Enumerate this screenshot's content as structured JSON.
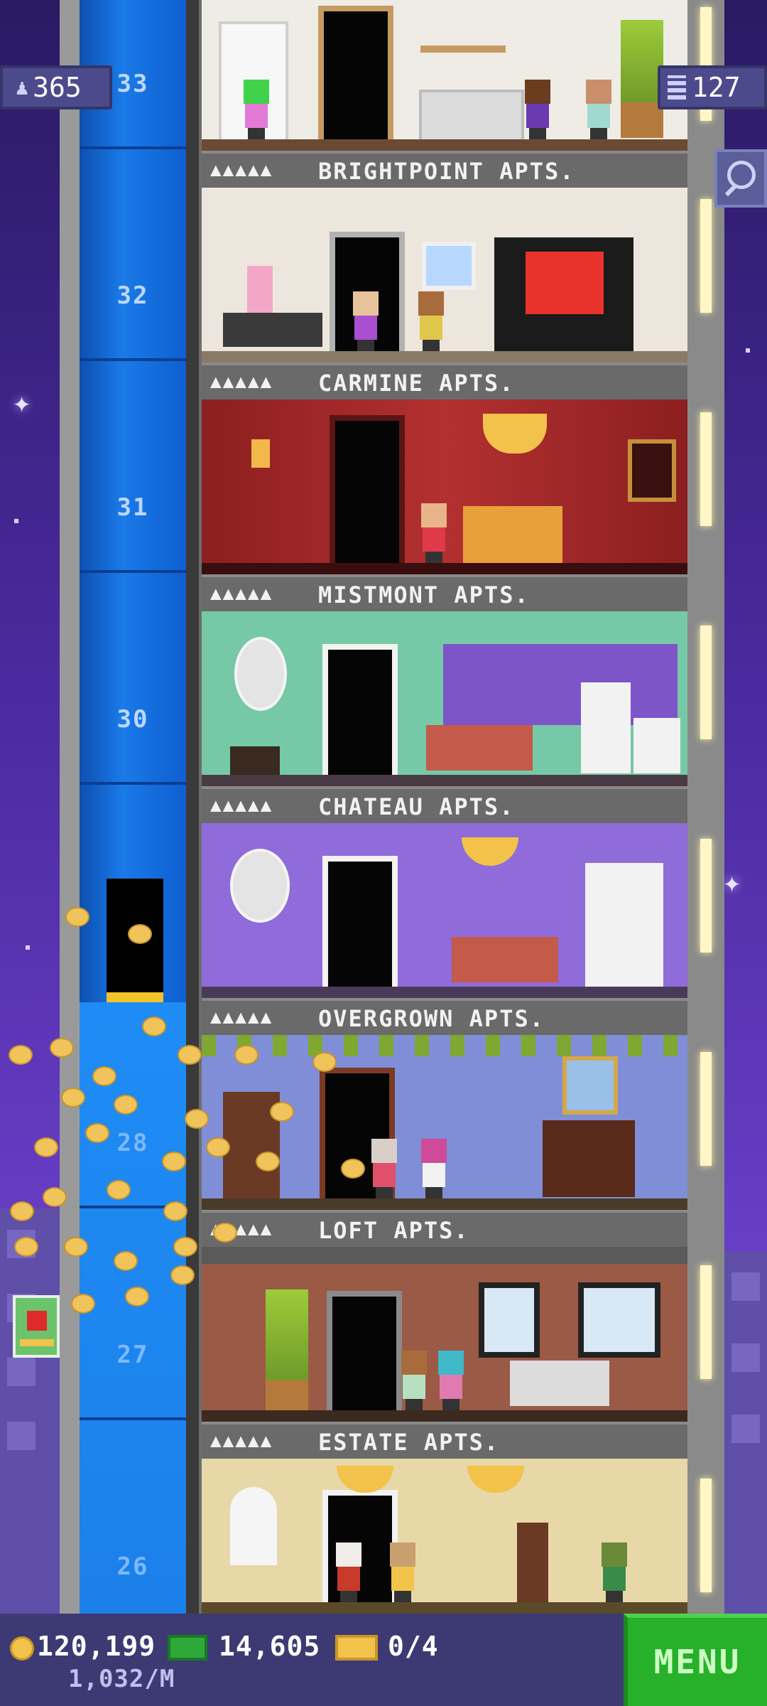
{
  "hud": {
    "population": "365",
    "floors_count": "127",
    "coins": "120,199",
    "bux": "14,605",
    "vip_cards": "0/4",
    "income_rate": "1,032/M",
    "menu_label": "MENU"
  },
  "shaft": {
    "floor_numbers": [
      "33",
      "32",
      "31",
      "30",
      "28",
      "27",
      "26"
    ]
  },
  "floors": [
    {
      "name": "BRIGHTPOINT APTS.",
      "stars": "▲▲▲▲▲"
    },
    {
      "name": "CARMINE APTS.",
      "stars": "▲▲▲▲▲"
    },
    {
      "name": "MISTMONT APTS.",
      "stars": "▲▲▲▲▲"
    },
    {
      "name": "CHATEAU APTS.",
      "stars": "▲▲▲▲▲"
    },
    {
      "name": "OVERGROWN APTS.",
      "stars": "▲▲▲▲▲"
    },
    {
      "name": "LOFT APTS.",
      "stars": "▲▲▲▲▲"
    },
    {
      "name": "ESTATE APTS.",
      "stars": "▲▲▲▲▲"
    }
  ],
  "colors": {
    "sky": "#4a2a9e",
    "shaft_blue": "#1a7ae8",
    "menu_green": "#27b02a",
    "bottom_bar": "#3d3a73"
  },
  "icons": [
    "population-icon",
    "floors-icon",
    "search-icon",
    "coin-icon",
    "bux-icon",
    "vip-card-icon",
    "food-icon"
  ]
}
